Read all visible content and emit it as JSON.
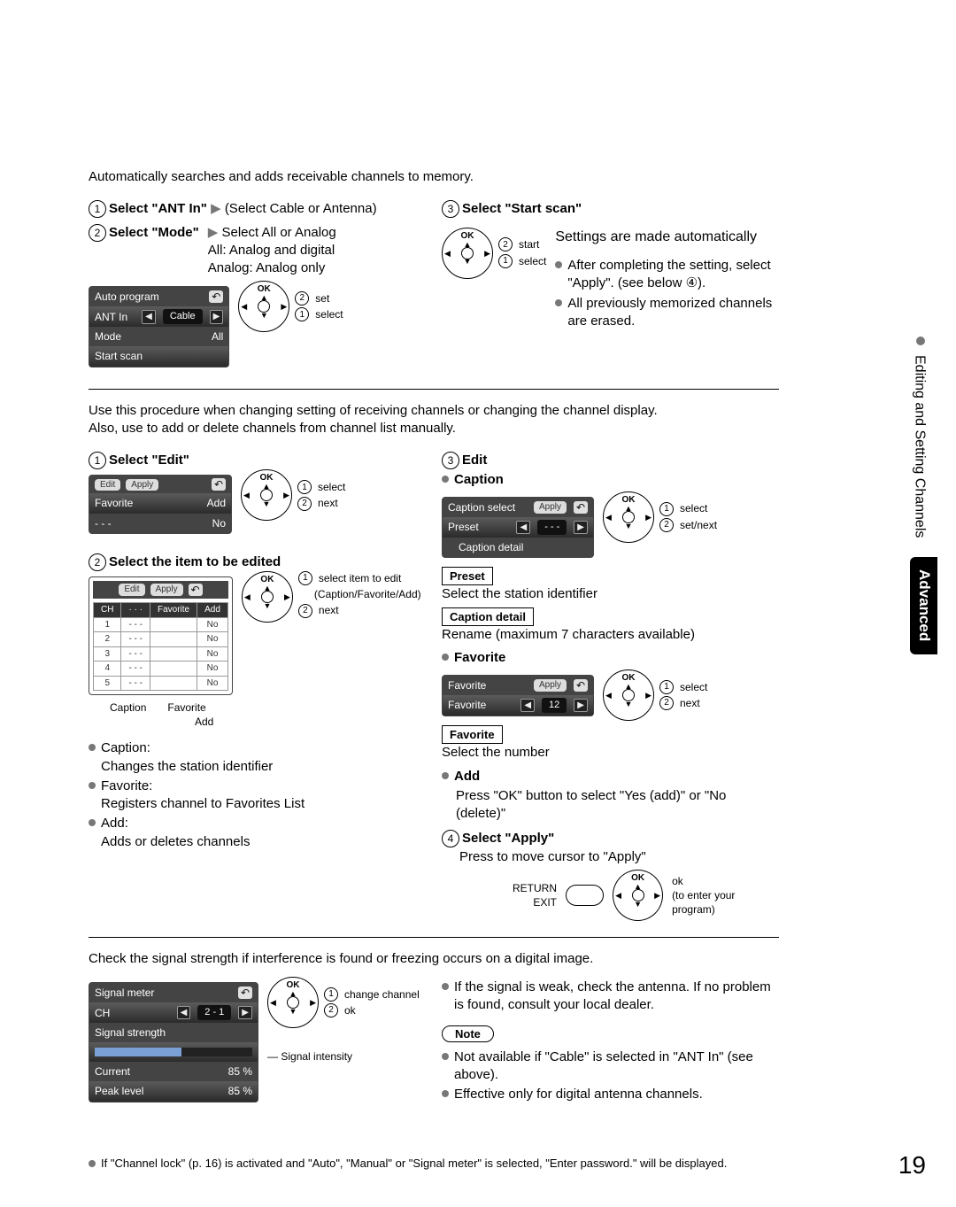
{
  "pagenum": "19",
  "sidebar": {
    "crumb": "Editing and Setting Channels",
    "adv": "Advanced"
  },
  "s1": {
    "intro": "Automatically searches and adds receivable channels to memory.",
    "step1_pre": "Select \"ANT In\"",
    "step1_post": "(Select Cable or Antenna)",
    "step2_pre": "Select \"Mode\"",
    "step2_a": "Select All or Analog",
    "step2_b": "All: Analog and digital",
    "step2_c": "Analog: Analog only",
    "step3": "Select \"Start scan\"",
    "right1": "Settings are made automatically",
    "rb1": "After completing the setting, select \"Apply\". (see below ④).",
    "rb2": "All previously memorized channels are erased.",
    "p2_a": "set",
    "p2_b": "select",
    "p3_a": "start",
    "p3_b": "select",
    "osd": {
      "title": "Auto program",
      "r1": "ANT In",
      "r1v": "Cable",
      "r2": "Mode",
      "r2v": "All",
      "r3": "Start scan"
    }
  },
  "s2": {
    "intro1": "Use this procedure when changing setting of receiving channels or changing the channel display.",
    "intro2": "Also, use to add or delete channels from channel list manually.",
    "left": {
      "h1": "Select \"Edit\"",
      "osd": {
        "edit": "Edit",
        "apply": "Apply",
        "favorite": "Favorite",
        "fvv": "Add",
        "dots": "- - -",
        "dotsv": "No"
      },
      "p1a": "select",
      "p1b": "next",
      "h2": "Select the item to be edited",
      "p2a": "select item to edit",
      "p2b": "(Caption/Favorite/Add)",
      "p2c": "next",
      "tbl": {
        "c1": "CH",
        "c2": "Caption",
        "c3": "Favorite",
        "c4": "Add",
        "dash": "- - -",
        "no": "No",
        "cap": "Caption",
        "fav": "Favorite",
        "add": "Add"
      },
      "b1h": "Caption:",
      "b1": "Changes the station identifier",
      "b2h": "Favorite:",
      "b2": "Registers channel to Favorites List",
      "b3h": "Add:",
      "b3": "Adds or deletes channels"
    },
    "right": {
      "h3": "Edit",
      "capH": "Caption",
      "capOsd": {
        "t": "Caption select",
        "apply": "Apply",
        "preset": "Preset",
        "presetv": "- - -",
        "detail": "Caption detail"
      },
      "capP1": "select",
      "capP2": "set/next",
      "presetTag": "Preset",
      "presetTxt": "Select the station identifier",
      "detailTag": "Caption detail",
      "detailTxt": "Rename (maximum 7 characters available)",
      "favH": "Favorite",
      "favOsd": {
        "t": "Favorite",
        "apply": "Apply",
        "r": "Favorite",
        "v": "12"
      },
      "favP1": "select",
      "favP2": "next",
      "favTag": "Favorite",
      "favTxt": "Select the number",
      "addH": "Add",
      "addTxt": "Press \"OK\" button to select \"Yes (add)\" or \"No (delete)\"",
      "h4": "Select \"Apply\"",
      "h4t": "Press to move cursor to  \"Apply\"",
      "ret": "RETURN",
      "exit": "EXIT",
      "ok": "ok",
      "okb": "(to enter your program)"
    }
  },
  "s3": {
    "intro": "Check the signal strength if interference is found or freezing occurs on a digital image.",
    "osd": {
      "t": "Signal meter",
      "r1": "CH",
      "r1v": "2 - 1",
      "r2": "Signal strength",
      "r3": "Current",
      "r3v": "85 %",
      "r4": "Peak level",
      "r4v": "85 %"
    },
    "p1": "change channel",
    "p2": "ok",
    "ann": "Signal intensity",
    "rb1": "If the signal is weak, check the antenna. If no problem is found, consult your local dealer.",
    "note": "Note",
    "n1": "Not available if \"Cable\" is selected in \"ANT In\" (see above).",
    "n2": "Effective only for digital antenna channels."
  },
  "foot": "If \"Channel lock\" (p. 16) is activated and \"Auto\", \"Manual\" or \"Signal meter\" is selected, \"Enter password.\" will be displayed."
}
